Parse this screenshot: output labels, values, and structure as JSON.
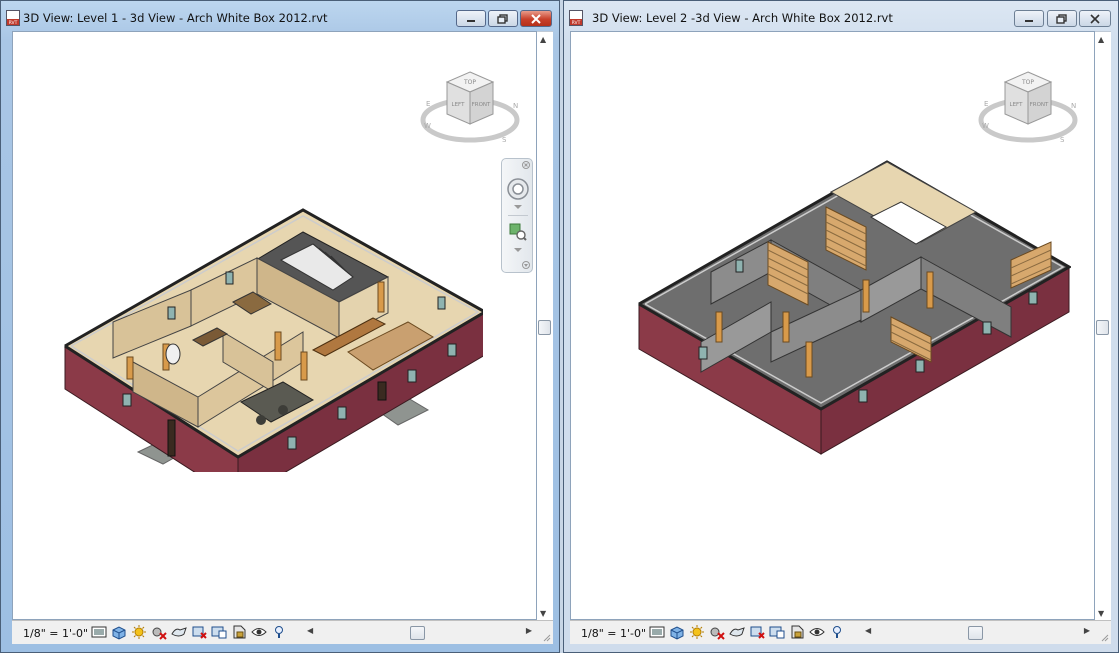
{
  "windows": [
    {
      "title": "3D View: Level 1 - 3d View - Arch White Box 2012.rvt",
      "app_icon": "revit-file-icon",
      "app_icon_text": "RVT",
      "state": "active",
      "scale": "1/8\" = 1'-0\"",
      "viewcube": {
        "top": "TOP",
        "left": "LEFT",
        "front": "FRONT",
        "compass": [
          "N",
          "W",
          "S",
          "E"
        ]
      },
      "nav_bar": {
        "tools": [
          "steering-wheel-icon",
          "zoom-region-icon"
        ]
      }
    },
    {
      "title": "3D View: Level 2 -3d View - Arch White Box 2012.rvt",
      "app_icon": "revit-file-icon",
      "app_icon_text": "RVT",
      "state": "inactive",
      "scale": "1/8\" = 1'-0\"",
      "viewcube": {
        "top": "TOP",
        "left": "LEFT",
        "front": "FRONT",
        "compass": [
          "N",
          "W",
          "S",
          "E"
        ]
      }
    }
  ],
  "view_control_bar": [
    "visual-style-icon",
    "3d-box-icon",
    "sun-path-icon",
    "shadows-off-icon",
    "show-rendering-icon",
    "crop-view-icon",
    "show-crop-region-icon",
    "unlock-3d-view-icon",
    "temporary-hide-icon",
    "reveal-hidden-icon"
  ],
  "colors": {
    "exterior_wall": "#8b3a48",
    "floor_tan": "#e7d6b0",
    "door_wood": "#d89a4a",
    "grey_floor": "#6e6e6e",
    "active_frame": "#a9c6e5",
    "inactive_frame": "#d2dfee"
  }
}
